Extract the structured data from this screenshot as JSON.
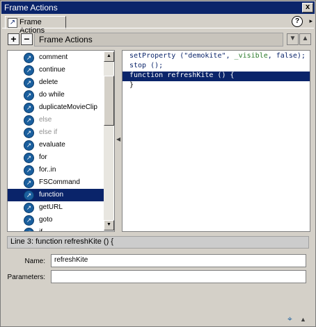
{
  "window": {
    "title": "Frame Actions",
    "close_glyph": "x"
  },
  "tab": {
    "label": "Frame Actions",
    "icon": "frame-actions-icon"
  },
  "toolbar": {
    "add_label": "+",
    "remove_label": "−",
    "category_dropdown": "Frame Actions",
    "move_down": "▼",
    "move_up": "▲",
    "help": "?",
    "menu_arrow": "▸"
  },
  "actions_list": {
    "items": [
      {
        "label": "comment",
        "dim": false,
        "selected": false
      },
      {
        "label": "continue",
        "dim": false,
        "selected": false
      },
      {
        "label": "delete",
        "dim": false,
        "selected": false
      },
      {
        "label": "do while",
        "dim": false,
        "selected": false
      },
      {
        "label": "duplicateMovieClip",
        "dim": false,
        "selected": false
      },
      {
        "label": "else",
        "dim": true,
        "selected": false
      },
      {
        "label": "else if",
        "dim": true,
        "selected": false
      },
      {
        "label": "evaluate",
        "dim": false,
        "selected": false
      },
      {
        "label": "for",
        "dim": false,
        "selected": false
      },
      {
        "label": "for..in",
        "dim": false,
        "selected": false
      },
      {
        "label": "FSCommand",
        "dim": false,
        "selected": false
      },
      {
        "label": "function",
        "dim": false,
        "selected": true
      },
      {
        "label": "getURL",
        "dim": false,
        "selected": false
      },
      {
        "label": "goto",
        "dim": false,
        "selected": false
      },
      {
        "label": "if",
        "dim": false,
        "selected": false
      }
    ]
  },
  "code": {
    "lines": [
      "setProperty (\"demokite\", _visible, false);",
      "stop ();",
      "function refreshKite () {",
      "}"
    ],
    "selected_line": 2
  },
  "status": {
    "text": "Line 3: function refreshKite () {"
  },
  "params": {
    "name_label": "Name:",
    "name_value": "refreshKite",
    "parameters_label": "Parameters:",
    "parameters_value": ""
  },
  "colors": {
    "selection": "#0a246a",
    "icon_blue": "#1a5f9e"
  }
}
